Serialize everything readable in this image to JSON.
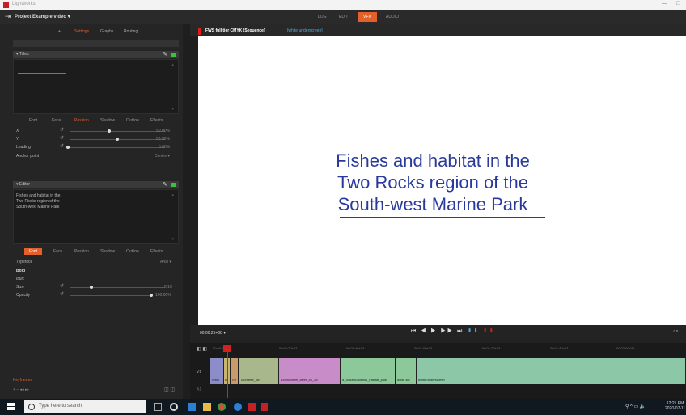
{
  "window": {
    "app_title": "Lightworks",
    "min_glyph": "—",
    "max_glyph": "□"
  },
  "menubar": {
    "project_title": "Project Example video ▾",
    "modes": [
      "LOG",
      "EDIT",
      "VFX",
      "AUDIO"
    ],
    "active_mode": "VFX"
  },
  "left_panel": {
    "tabs": [
      "+",
      "Settings",
      "Graphs",
      "Routing"
    ],
    "title_section": {
      "header": "▾ Titles",
      "subtabs": [
        "Font",
        "Face",
        "Position",
        "Shadow",
        "Outline",
        "Effects"
      ],
      "active_subtab": "Position",
      "properties": [
        {
          "label": "X",
          "value": "50.00%"
        },
        {
          "label": "Y",
          "value": "50.00%"
        },
        {
          "label": "Leading",
          "value": "0.00%"
        },
        {
          "label": "Anchor point",
          "value": "Centre ▾"
        }
      ]
    },
    "editor_section": {
      "header": "▾ Editor",
      "lines": [
        "Fishes and habitat in the",
        "Two Rocks region of the",
        "South-west Marine Park"
      ],
      "subtabs": [
        "Font",
        "Face",
        "Position",
        "Shadow",
        "Outline",
        "Effects"
      ],
      "active_subtab": "Font",
      "properties": [
        {
          "label": "Typeface",
          "value": "Arial ▾"
        },
        {
          "label": "Bold",
          "value": ""
        },
        {
          "label": "Italic",
          "value": ""
        },
        {
          "label": "Size",
          "value": "0.10"
        },
        {
          "label": "Opacity",
          "value": "100.00%"
        }
      ]
    },
    "keyframes_label": "Keyframes",
    "keyframe_controls": "+ − ◂◂ ▸▸"
  },
  "viewer": {
    "sequence_title": "FWS full tier CMYK (Sequence)",
    "sequence_tag": "[white underscreen]",
    "title_lines": [
      "Fishes and habitat in the",
      "Two Rocks region of the",
      "South-west Marine Park"
    ],
    "text_color": "#2a3a9c"
  },
  "transport": {
    "timecode": "00:00:25+08 ▾",
    "controls": "⏮ ◀ ▶ ▶▶ ⏭"
  },
  "timeline": {
    "ruler_ticks": [
      "00:00:00+00",
      "00:00:20+03",
      "00:00:40+03",
      "00:01:00+03",
      "00:01:20+03",
      "00:01:40+03",
      "00:02:00+03"
    ],
    "video_track": "V1",
    "audio_track": "A1",
    "clips": [
      {
        "label": "Wide",
        "color": "#8c8cc8"
      },
      {
        "label": "sh",
        "color": "#c8b46c"
      },
      {
        "label": "Thr",
        "color": "#c89a6c"
      },
      {
        "label": "Tournette_fon",
        "color": "#a8b88c"
      },
      {
        "label": "Echinoderm_layer_40_28",
        "color": "#c88cc8"
      },
      {
        "label": "d_Siliceousbanks_habitat_plus",
        "color": "#8cc89a"
      },
      {
        "label": "white scr",
        "color": "#8cc89a"
      },
      {
        "label": "white underscreen",
        "color": "#8cc8a8"
      }
    ]
  },
  "taskbar": {
    "search_placeholder": "Type here to search",
    "clock_time": "12:21 PM",
    "clock_date": "2020-07-11"
  }
}
